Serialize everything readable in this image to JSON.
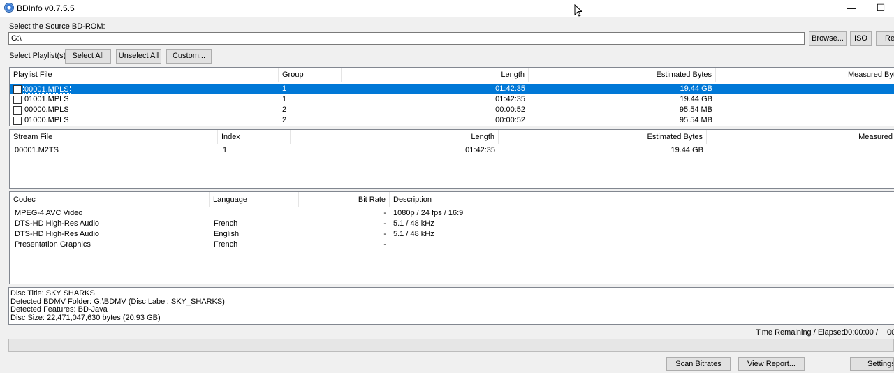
{
  "window": {
    "title": "BDInfo v0.7.5.5",
    "minimize_glyph": "—",
    "maximize_glyph": "☐"
  },
  "source": {
    "label": "Select the Source BD-ROM:",
    "path": "G:\\",
    "browse_label": "Browse...",
    "iso_label": "ISO",
    "rescan_label": "Re"
  },
  "playlist_controls": {
    "label": "Select Playlist(s):",
    "select_all": "Select All",
    "unselect_all": "Unselect All",
    "custom": "Custom..."
  },
  "playlists": {
    "columns": [
      "Playlist File",
      "Group",
      "Length",
      "Estimated Bytes",
      "Measured Byte"
    ],
    "rows": [
      {
        "file": "00001.MPLS",
        "group": "1",
        "length": "01:42:35",
        "estimated": "19.44 GB",
        "selected": true
      },
      {
        "file": "01001.MPLS",
        "group": "1",
        "length": "01:42:35",
        "estimated": "19.44 GB",
        "selected": false
      },
      {
        "file": "00000.MPLS",
        "group": "2",
        "length": "00:00:52",
        "estimated": "95.54 MB",
        "selected": false
      },
      {
        "file": "01000.MPLS",
        "group": "2",
        "length": "00:00:52",
        "estimated": "95.54 MB",
        "selected": false
      }
    ]
  },
  "streams": {
    "columns": [
      "Stream File",
      "Index",
      "Length",
      "Estimated Bytes",
      "Measured"
    ],
    "rows": [
      {
        "file": "00001.M2TS",
        "index": "1",
        "length": "01:42:35",
        "estimated": "19.44 GB"
      }
    ]
  },
  "codecs": {
    "columns": [
      "Codec",
      "Language",
      "Bit Rate",
      "Description"
    ],
    "rows": [
      {
        "codec": "MPEG-4 AVC Video",
        "language": "",
        "bitrate": "-",
        "description": "1080p / 24 fps / 16:9"
      },
      {
        "codec": "DTS-HD High-Res Audio",
        "language": "French",
        "bitrate": "-",
        "description": "5.1 / 48 kHz"
      },
      {
        "codec": "DTS-HD High-Res Audio",
        "language": "English",
        "bitrate": "-",
        "description": "5.1 / 48 kHz"
      },
      {
        "codec": "Presentation Graphics",
        "language": "French",
        "bitrate": "-",
        "description": ""
      }
    ]
  },
  "disc_info": {
    "lines": [
      "Disc Title: SKY SHARKS",
      "Detected BDMV Folder: G:\\BDMV (Disc Label: SKY_SHARKS)",
      "Detected Features: BD-Java",
      "Disc Size: 22,471,047,630 bytes (20.93 GB)"
    ]
  },
  "status": {
    "time_label": "Time Remaining / Elapsed:",
    "time_remaining": "00:00:00",
    "separator": "/",
    "time_elapsed": "00",
    "progress": 0
  },
  "actions": {
    "scan_bitrates": "Scan Bitrates",
    "view_report": "View Report...",
    "settings": "Settings..."
  }
}
